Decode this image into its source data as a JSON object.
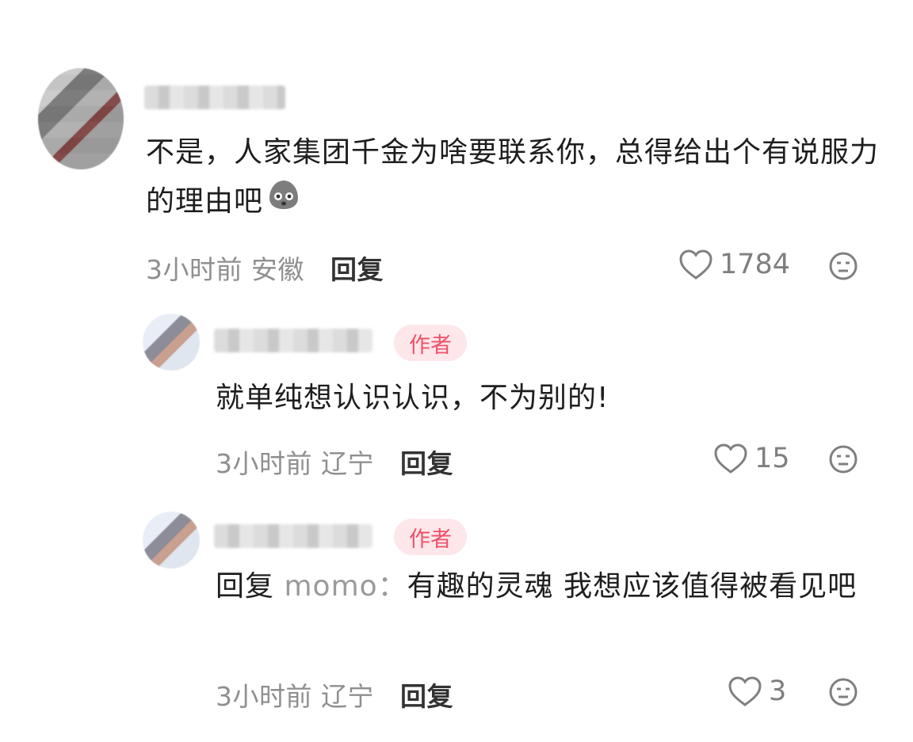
{
  "comments": [
    {
      "text": "不是，人家集团千金为啥要联系你，总得给出个有说服力的理由吧",
      "emoji_icon": "face-emoji-icon",
      "time": "3小时前",
      "location": "安徽",
      "reply_label": "回复",
      "likes": "1784"
    },
    {
      "badge": "作者",
      "text": "就单纯想认识认识，不为别的!",
      "time": "3小时前",
      "location": "辽宁",
      "reply_label": "回复",
      "likes": "15"
    },
    {
      "badge": "作者",
      "reply_prefix": "回复",
      "mention": "momo：",
      "text": "有趣的灵魂 我想应该值得被看见吧",
      "time": "3小时前",
      "location": "辽宁",
      "reply_label": "回复",
      "likes": "3"
    }
  ],
  "icons": {
    "like": "heart-outline-icon",
    "dislike": "neutral-face-icon"
  },
  "colors": {
    "author_badge_bg": "#fde7ea",
    "author_badge_text": "#f0506b",
    "meta_text": "#8f8f8f"
  }
}
